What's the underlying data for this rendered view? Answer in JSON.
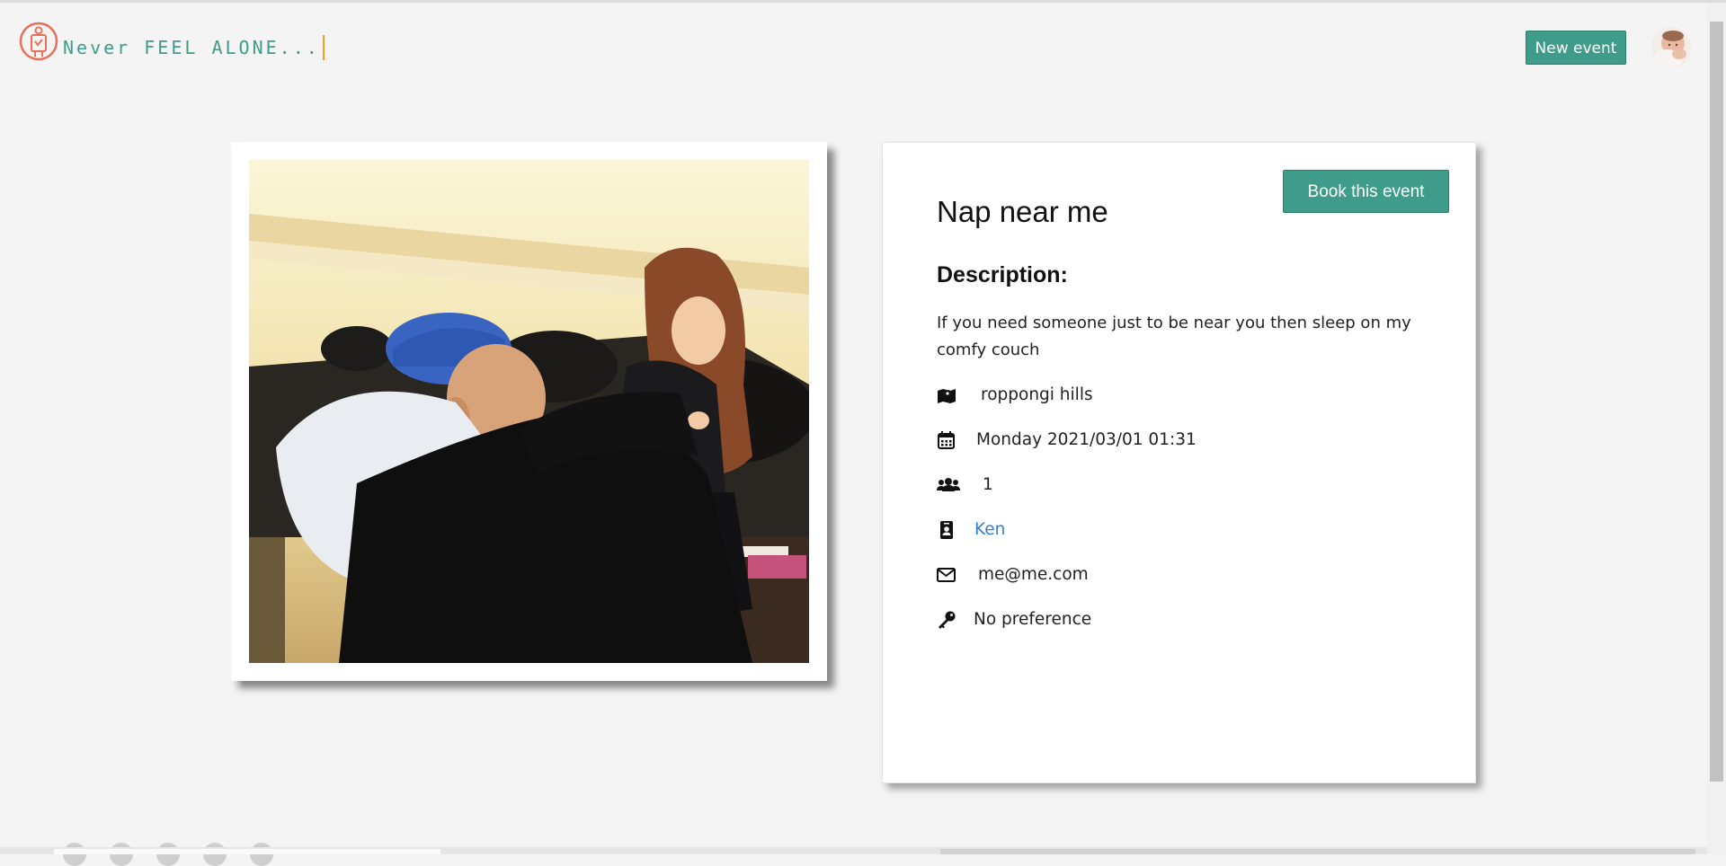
{
  "brand": {
    "tagline": "Never FEEL ALONE...",
    "logo_icon": "person-in-circle-icon",
    "accent_color": "#3f9b8a",
    "logo_color": "#e8705a"
  },
  "navbar": {
    "new_event_label": "New event",
    "avatar_icon": "baby-avatar"
  },
  "event": {
    "book_label": "Book this event",
    "title": "Nap near me",
    "description_heading": "Description:",
    "description": "If you need someone just to be near you then sleep on my comfy couch",
    "location_icon": "map-marker-icon",
    "location": "roppongi hills",
    "date_icon": "calendar-icon",
    "datetime": "Monday 2021/03/01 01:31",
    "attendees_icon": "users-icon",
    "attendees": "1",
    "host_icon": "id-badge-icon",
    "host": "Ken",
    "email_icon": "envelope-icon",
    "email": "me@me.com",
    "preference_icon": "key-icon",
    "preference": "No preference"
  }
}
